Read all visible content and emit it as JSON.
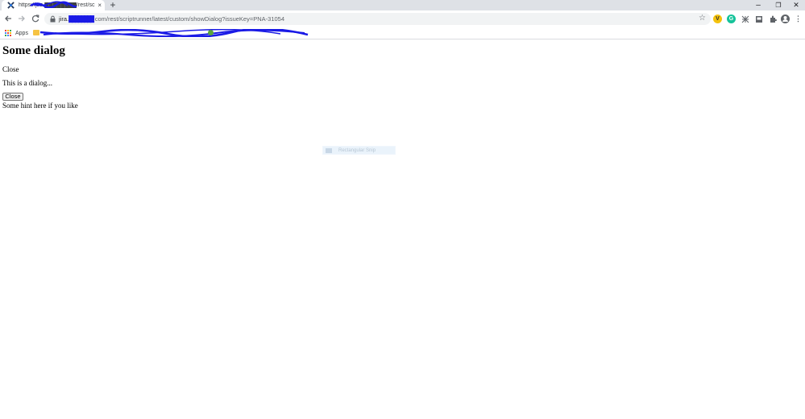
{
  "browser": {
    "tab": {
      "title": "https://jira.████████/rest/sc",
      "close": "×",
      "favicon_icon": "jira-favicon-icon"
    },
    "new_tab": "+",
    "window_controls": {
      "minimize": "–",
      "restore": "❐",
      "close": "✕"
    },
    "url": {
      "prefix": "jira.",
      "redacted": "████████",
      "path": ".com/rest/scriptrunner/latest/custom/showDialog?issueKey=PNA-31054"
    },
    "extensions": [
      {
        "name": "extension-v-icon",
        "letter": "V",
        "bg": "#f4c20d",
        "fg": "#333333"
      },
      {
        "name": "grammarly-icon",
        "letter": "G",
        "bg": "#15c39a",
        "fg": "#ffffff"
      }
    ],
    "bookmarks": {
      "apps_label": "Apps"
    }
  },
  "page": {
    "title": "Some dialog",
    "close_text": "Close",
    "dialog_text": "This is a dialog...",
    "close_button": "Close",
    "hint": "Some hint here if you like"
  },
  "overlay": {
    "label": "Rectangular Snip"
  },
  "colors": {
    "tabstrip": "#dee1e6",
    "omnibox": "#f1f3f4",
    "scribble": "#1a1ae6"
  }
}
